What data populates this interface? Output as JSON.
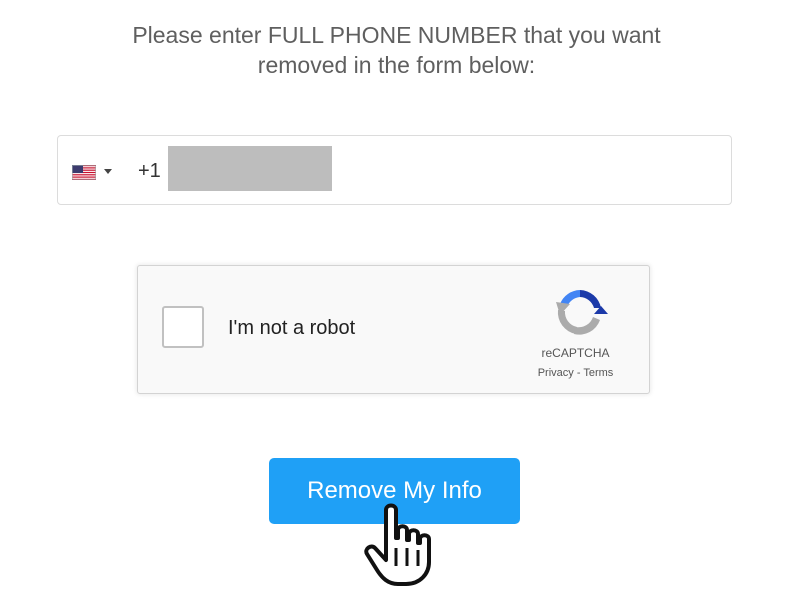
{
  "instructions": {
    "line1": "Please enter FULL PHONE NUMBER that you want",
    "line2": "removed in the form below:"
  },
  "phone_input": {
    "country_flag_icon": "us-flag-icon",
    "dial_code": "+1",
    "value_redacted": true
  },
  "recaptcha": {
    "label": "I'm not a robot",
    "brand": "reCAPTCHA",
    "privacy": "Privacy",
    "separator": " - ",
    "terms": "Terms",
    "checked": false
  },
  "submit": {
    "label": "Remove My Info",
    "color": "#1fa0f6"
  },
  "cursor_icon": "pointing-hand-cursor-icon"
}
